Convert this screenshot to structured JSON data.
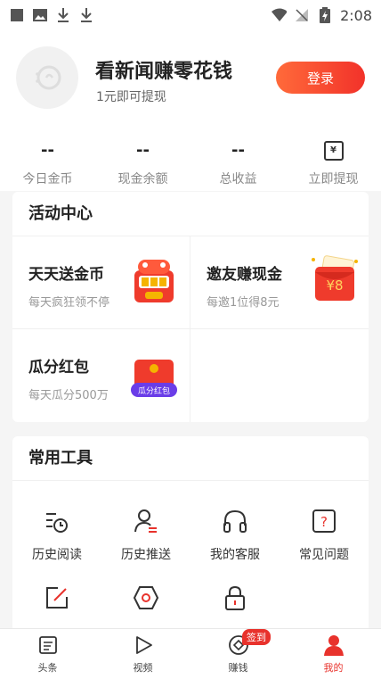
{
  "status_bar": {
    "time": "2:08",
    "left_icons": [
      "stop-icon",
      "image-icon",
      "download-icon",
      "download-icon"
    ],
    "right_icons": [
      "wifi-icon",
      "no-signal-icon",
      "battery-charging-icon"
    ]
  },
  "header": {
    "title": "看新闻赚零花钱",
    "subtitle": "1元即可提现",
    "login_label": "登录",
    "accent_color": "#f2322a"
  },
  "stats": [
    {
      "value": "--",
      "label": "今日金币"
    },
    {
      "value": "--",
      "label": "现金余额"
    },
    {
      "value": "--",
      "label": "总收益"
    },
    {
      "icon": "withdraw-icon",
      "icon_text": "¥",
      "label": "立即提现"
    }
  ],
  "activity": {
    "title": "活动中心",
    "items": [
      {
        "name": "天天送金币",
        "desc": "每天疯狂领不停",
        "icon": "slot-machine-icon"
      },
      {
        "name": "邀友赚现金",
        "desc": "每邀1位得8元",
        "icon": "red-envelope-icon",
        "icon_text": "¥8"
      },
      {
        "name": "瓜分红包",
        "desc": "每天瓜分500万",
        "icon": "red-packet-icon",
        "icon_text": "瓜分红包"
      }
    ]
  },
  "tools": {
    "title": "常用工具",
    "items": [
      {
        "label": "历史阅读",
        "icon": "history-read-icon"
      },
      {
        "label": "历史推送",
        "icon": "history-push-icon"
      },
      {
        "label": "我的客服",
        "icon": "headset-icon"
      },
      {
        "label": "常见问题",
        "icon": "question-icon",
        "icon_text": "?"
      },
      {
        "label": "",
        "icon": "edit-icon"
      },
      {
        "label": "",
        "icon": "settings-icon"
      },
      {
        "label": "",
        "icon": "lock-icon"
      }
    ]
  },
  "bottom_nav": {
    "items": [
      {
        "label": "头条",
        "icon": "news-icon"
      },
      {
        "label": "视频",
        "icon": "play-icon"
      },
      {
        "label": "赚钱",
        "icon": "coin-icon",
        "badge": "签到"
      },
      {
        "label": "我的",
        "icon": "profile-icon",
        "active": true
      }
    ]
  }
}
